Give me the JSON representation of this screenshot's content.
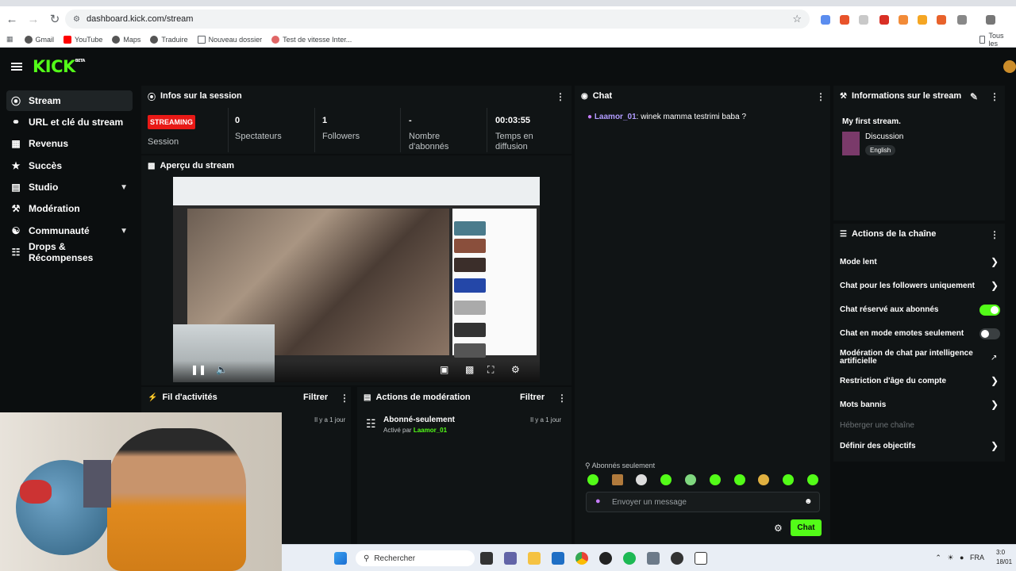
{
  "browser": {
    "url": "dashboard.kick.com/stream",
    "bookmarks": [
      "Gmail",
      "YouTube",
      "Maps",
      "Traduire",
      "Nouveau dossier",
      "Test de vitesse Inter..."
    ],
    "all_bookmarks": "Tous les"
  },
  "kick": {
    "logo": "KICK",
    "logo_badge": "BETA"
  },
  "sidebar": {
    "items": [
      {
        "label": "Stream",
        "icon": "broadcast-icon"
      },
      {
        "label": "URL et clé du stream",
        "icon": "link-icon"
      },
      {
        "label": "Revenus",
        "icon": "revenue-icon"
      },
      {
        "label": "Succès",
        "icon": "trophy-icon"
      },
      {
        "label": "Studio",
        "icon": "studio-icon"
      },
      {
        "label": "Modération",
        "icon": "wrench-icon"
      },
      {
        "label": "Communauté",
        "icon": "community-icon"
      },
      {
        "label": "Drops & Récompenses",
        "icon": "gift-icon"
      }
    ]
  },
  "session": {
    "title": "Infos sur la session",
    "badge": "STREAMING",
    "badge_label": "Session",
    "stats": [
      {
        "value": "0",
        "label": "Spectateurs"
      },
      {
        "value": "1",
        "label": "Followers"
      },
      {
        "value": "-",
        "label": "Nombre d'abonnés"
      },
      {
        "value": "00:03:55",
        "label": "Temps en diffusion"
      }
    ]
  },
  "preview": {
    "title": "Aperçu du stream"
  },
  "activity": {
    "title": "Fil d'activités",
    "filter": "Filtrer",
    "time": "Il y a 1 jour"
  },
  "moderation": {
    "title": "Actions de modération",
    "filter": "Filtrer",
    "item_title": "Abonné-seulement",
    "item_by": "Activé par",
    "item_user": "Laamor_01",
    "time": "Il y a 1 jour"
  },
  "chat": {
    "title": "Chat",
    "message_user": "Laamor_01",
    "message_text": ": winek mamma testrimi baba ?",
    "subs_only": "Abonnés seulement",
    "input_placeholder": "Envoyer un message",
    "send_label": "Chat"
  },
  "stream_info": {
    "title": "Informations sur le stream",
    "stream_title": "My first stream.",
    "category": "Discussion",
    "language": "English"
  },
  "channel_actions": {
    "title": "Actions de la chaîne",
    "items": [
      {
        "label": "Mode lent"
      },
      {
        "label": "Chat pour les followers uniquement"
      },
      {
        "label": "Chat réservé aux abonnés"
      },
      {
        "label": "Chat en mode emotes seulement"
      },
      {
        "label": "Modération de chat par intelligence artificielle"
      },
      {
        "label": "Restriction d'âge du compte"
      },
      {
        "label": "Mots bannis"
      },
      {
        "label": "Héberger une chaîne"
      },
      {
        "label": "Définir des objectifs"
      }
    ],
    "subs_only_toggle": true,
    "emotes_only_toggle": false
  },
  "taskbar": {
    "search": "Rechercher",
    "lang": "FRA",
    "time": "3:0",
    "date": "18/01"
  },
  "colors": {
    "accent": "#53fc18",
    "live": "#e91916",
    "username": "#b19cff"
  }
}
